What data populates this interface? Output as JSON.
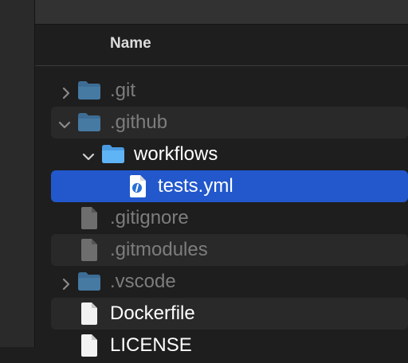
{
  "header": {
    "name_label": "Name"
  },
  "files": [
    {
      "label": ".git",
      "kind": "folder",
      "chevron": "right",
      "dim": true
    },
    {
      "label": ".github",
      "kind": "folder",
      "chevron": "down",
      "dim": true
    },
    {
      "label": "workflows",
      "kind": "folder",
      "chevron": "down",
      "dim": false
    },
    {
      "label": "tests.yml",
      "kind": "yaml-file",
      "chevron": "none",
      "dim": false,
      "selected": true
    },
    {
      "label": ".gitignore",
      "kind": "file",
      "chevron": "none",
      "dim": true
    },
    {
      "label": ".gitmodules",
      "kind": "file",
      "chevron": "none",
      "dim": true
    },
    {
      "label": ".vscode",
      "kind": "folder",
      "chevron": "right",
      "dim": true
    },
    {
      "label": "Dockerfile",
      "kind": "file",
      "chevron": "none",
      "dim": false
    },
    {
      "label": "LICENSE",
      "kind": "file",
      "chevron": "none",
      "dim": false
    }
  ],
  "colors": {
    "selection": "#2258cc",
    "folder_dim": "#3d6d94",
    "folder_bright": "#5fb4f5"
  }
}
